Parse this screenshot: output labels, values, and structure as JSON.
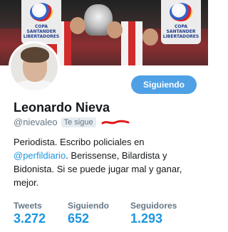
{
  "banner": {
    "logo_left": "COPA SANTANDER LIBERTADORES",
    "logo_right": "COPA SANTANDER LIBERTADORES"
  },
  "profile": {
    "name": "Leonardo Nieva",
    "handle": "@nievaleo",
    "follows_you": "Te sigue",
    "bio_1": "Periodista. Escribo policiales en",
    "bio_mention": "@perfildiario",
    "bio_2": ". Berissense, Bilardista y Bidonista. Si se puede jugar mal y ganar, mejor."
  },
  "follow_button": {
    "label": "Siguiendo"
  },
  "stats": {
    "tweets_label": "Tweets",
    "tweets_value": "3.272",
    "following_label": "Siguiendo",
    "following_value": "652",
    "followers_label": "Seguidores",
    "followers_value": "1.293"
  },
  "colors": {
    "accent": "#1b95e0",
    "button": "#4fa1e6",
    "muted": "#657786",
    "scribble": "#e01b1b"
  }
}
